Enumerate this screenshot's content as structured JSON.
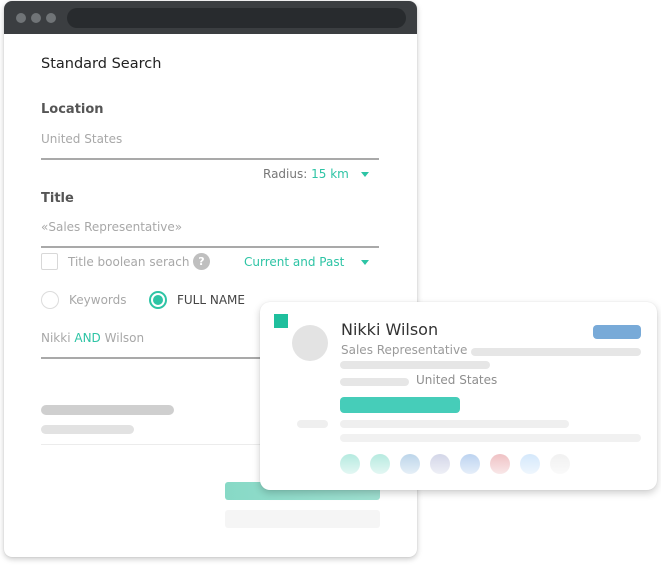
{
  "window": {
    "title": "Standard Search"
  },
  "location": {
    "label": "Location",
    "value": "United States",
    "radius_label": "Radius:",
    "radius_value": "15 km"
  },
  "title_field": {
    "label": "Title",
    "value": "«Sales Representative»",
    "boolean_label": "Title boolean serach",
    "boolean_checked": false,
    "help_icon": "?",
    "period_value": "Current and Past"
  },
  "search_mode": {
    "options": [
      {
        "label": "Keywords",
        "selected": false
      },
      {
        "label": "FULL NAME",
        "selected": true
      }
    ],
    "query_parts": [
      "Nikki",
      "AND",
      "Wilson"
    ]
  },
  "profile_card": {
    "name": "Nikki Wilson",
    "job_title": "Sales Representative",
    "country": "United States",
    "tag_colors": [
      "#b5eadf",
      "#b6eadf",
      "#bcd5ea",
      "#d3d6e8",
      "#bcd3f0",
      "#efc1c4",
      "#d4e8fb",
      "#f1f1f1"
    ]
  },
  "colors": {
    "accent": "#2ec4a5",
    "titlebar": "#3b3e41",
    "badge": "#78aad8"
  }
}
